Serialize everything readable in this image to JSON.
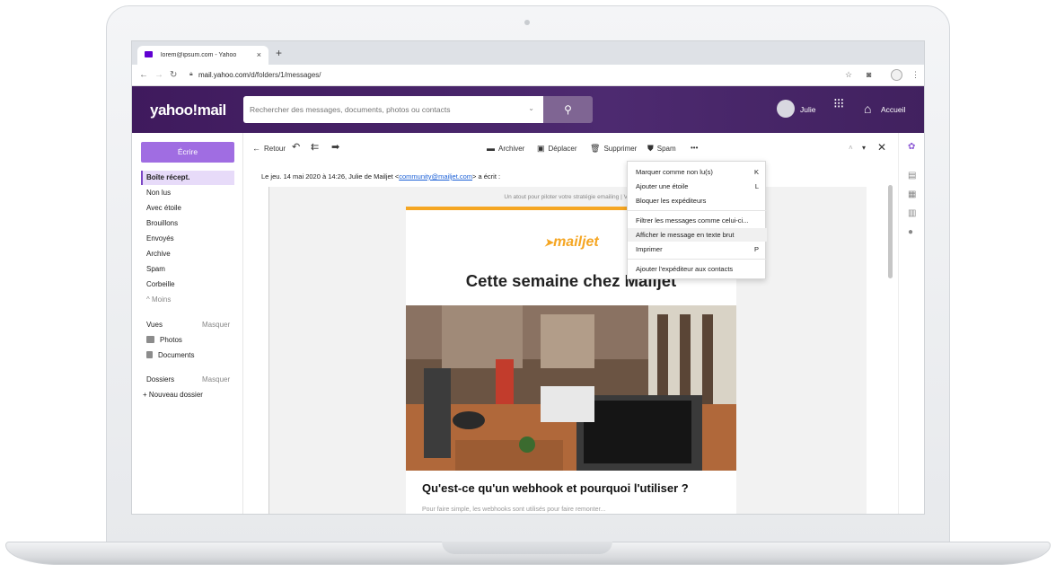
{
  "browser": {
    "tab_title": "lorem@ipsum.com - Yahoo",
    "tab_close": "×",
    "new_tab": "+",
    "url_host": "mail.yahoo.com",
    "url_path": "/d/folders/1/messages/"
  },
  "header": {
    "logo": "yahoo!mail",
    "search_placeholder": "Rechercher des messages, documents, photos ou contacts",
    "user_name": "Julie",
    "home_label": "Accueil"
  },
  "sidebar": {
    "compose_label": "Écrire",
    "folders": [
      {
        "label": "Boîte récept."
      },
      {
        "label": "Non lus"
      },
      {
        "label": "Avec étoile"
      },
      {
        "label": "Brouillons"
      },
      {
        "label": "Envoyés"
      },
      {
        "label": "Archive"
      },
      {
        "label": "Spam"
      },
      {
        "label": "Corbeille"
      },
      {
        "label": "^ Moins"
      }
    ],
    "views_label": "Vues",
    "views_hide": "Masquer",
    "views": [
      {
        "label": "Photos"
      },
      {
        "label": "Documents"
      }
    ],
    "folders_label": "Dossiers",
    "folders_hide": "Masquer",
    "new_folder": "+ Nouveau dossier"
  },
  "toolbar": {
    "back": "Retour",
    "archive": "Archiver",
    "move": "Déplacer",
    "delete": "Supprimer",
    "spam": "Spam",
    "more": "•••"
  },
  "message": {
    "from_prefix": "Le jeu. 14 mai 2020 à 14:26, Julie de Mailjet <",
    "from_email": "community@mailjet.com",
    "from_suffix": "> a écrit :",
    "preheader": "Un atout pour piloter votre stratégie emailing | Voi",
    "brand": "mailjet",
    "headline": "Cette semaine chez Mailjet",
    "subheading": "Qu'est-ce qu'un webhook et pourquoi l'utiliser ?",
    "paragraph": "Pour faire simple, les webhooks sont utilisés pour faire remonter..."
  },
  "menu": {
    "items": [
      {
        "label": "Marquer comme non lu(s)",
        "key": "K"
      },
      {
        "label": "Ajouter une étoile",
        "key": "L"
      },
      {
        "label": "Bloquer les expéditeurs",
        "key": ""
      },
      {
        "label": "Filtrer les messages comme celui-ci...",
        "key": ""
      },
      {
        "label": "Afficher le message en texte brut",
        "key": ""
      },
      {
        "label": "Imprimer",
        "key": "P"
      },
      {
        "label": "Ajouter l'expéditeur aux contacts",
        "key": ""
      }
    ]
  },
  "colors": {
    "header_purple": "#4d2a70",
    "compose_purple": "#a06de2",
    "mailjet_orange": "#f5a623"
  }
}
